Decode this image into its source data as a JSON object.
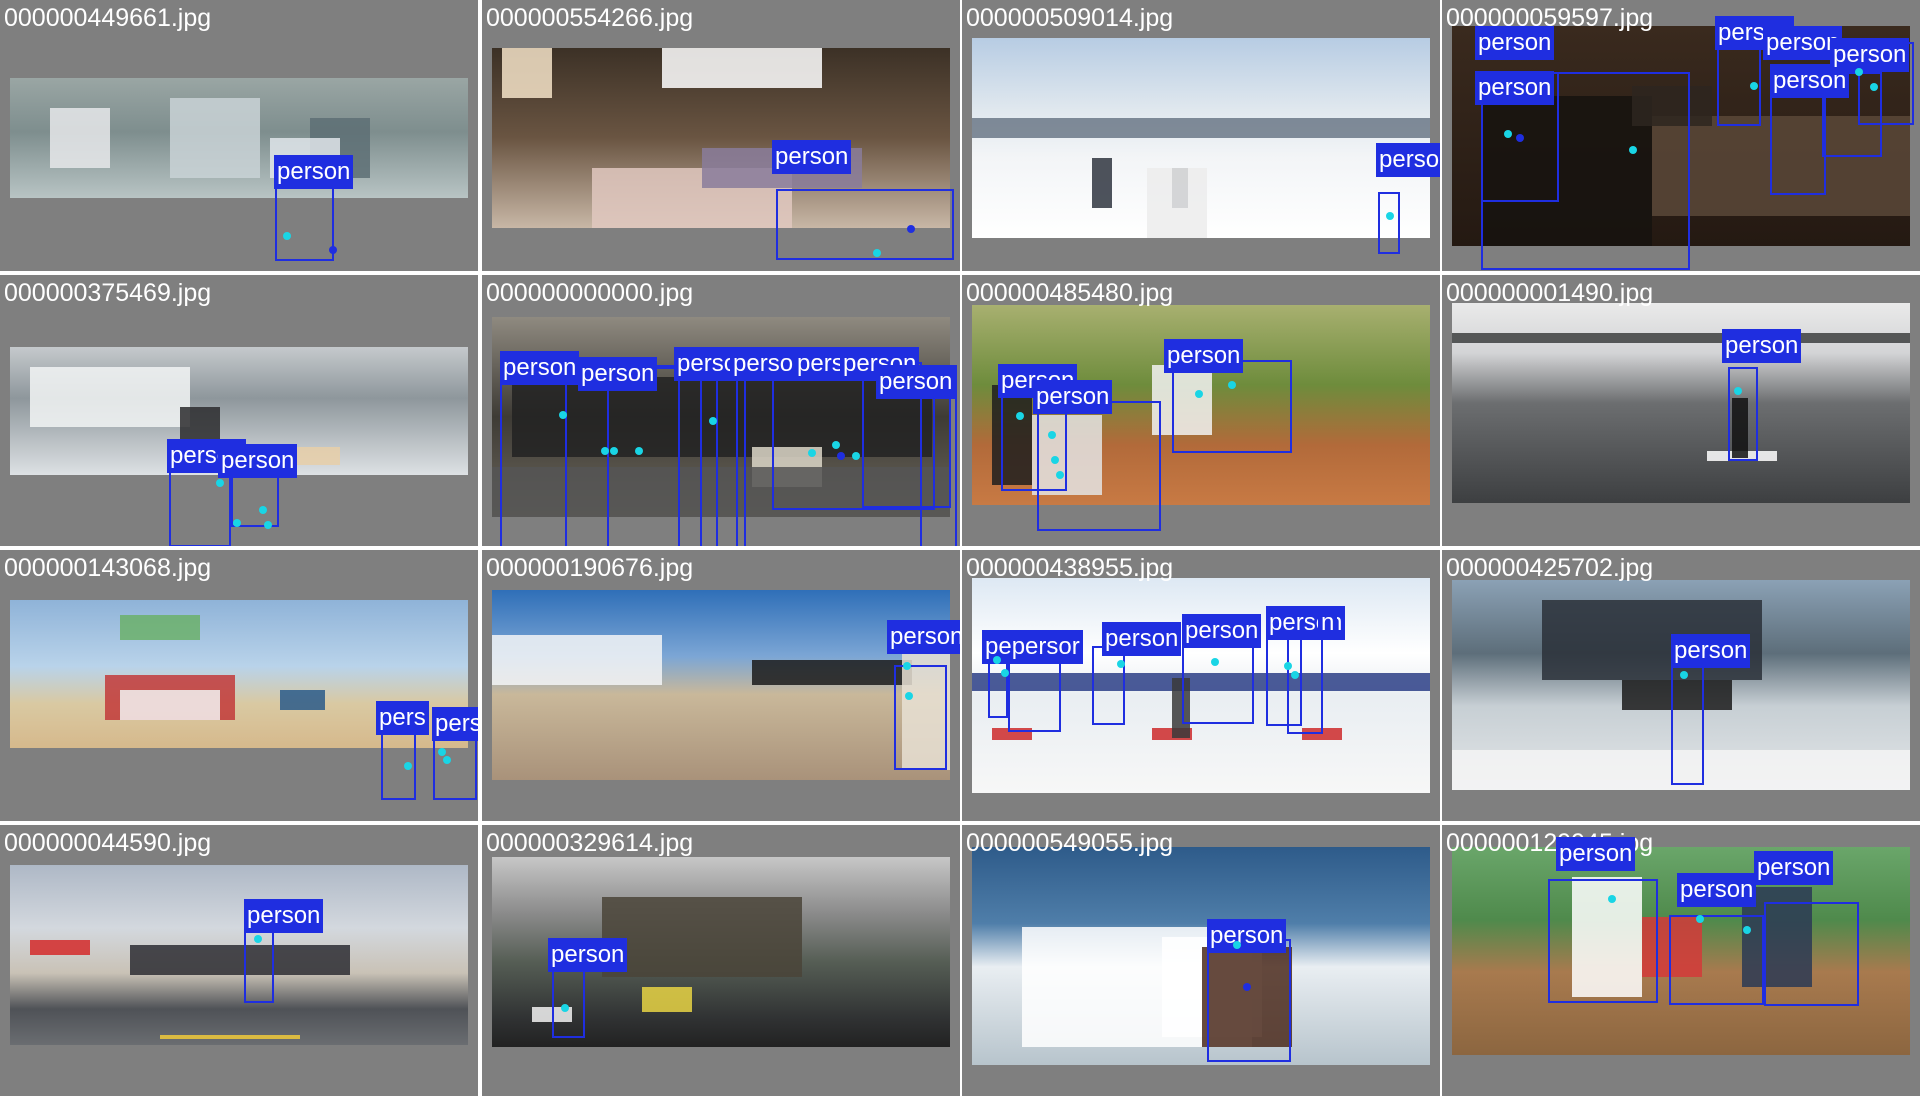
{
  "colors": {
    "tile_bg": "#7f7f7f",
    "box": "#1f2ee0",
    "label_text": "#ffffff",
    "keypoint": "#19d5e5"
  },
  "tiles": [
    {
      "filename": "000000449661.jpg",
      "scene": "hospital room with patient in bed",
      "labels": [
        "person"
      ]
    },
    {
      "filename": "000000554266.jpg",
      "scene": "bedroom panorama with person lying on bed",
      "labels": [
        "person"
      ]
    },
    {
      "filename": "000000509014.jpg",
      "scene": "snowy ski slope with skiers",
      "labels": [
        "person"
      ]
    },
    {
      "filename": "000000059597.jpg",
      "scene": "crowded dim room, boy taking photo with phone",
      "labels": [
        "person",
        "person",
        "person",
        "person",
        "person",
        "person"
      ]
    },
    {
      "filename": "000000375469.jpg",
      "scene": "surfers riding ocean wave",
      "labels": [
        "person",
        "person"
      ]
    },
    {
      "filename": "000000000000.jpg",
      "scene": "vintage photo of seated schoolboys",
      "labels": [
        "person",
        "person",
        "person",
        "person",
        "person",
        "person",
        "person"
      ]
    },
    {
      "filename": "000000485480.jpg",
      "scene": "baseball batter, catcher and umpire at home plate",
      "labels": [
        "person",
        "person",
        "person"
      ]
    },
    {
      "filename": "000000001490.jpg",
      "scene": "paddle boarder on grey water",
      "labels": [
        "person"
      ]
    },
    {
      "filename": "000000143068.jpg",
      "scene": "beach with kites, flags and pier",
      "labels": [
        "pers",
        "person"
      ]
    },
    {
      "filename": "000000190676.jpg",
      "scene": "airport apron with airplane and queue of people",
      "labels": [
        "person"
      ]
    },
    {
      "filename": "000000438955.jpg",
      "scene": "cross-country ski race in snow",
      "labels": [
        "pepersor",
        "person",
        "person",
        "person",
        "n"
      ]
    },
    {
      "filename": "000000425702.jpg",
      "scene": "surfer carrying board on beach under mountain",
      "labels": [
        "person"
      ]
    },
    {
      "filename": "000000044590.jpg",
      "scene": "motorcycles parked along a road",
      "labels": [
        "person"
      ]
    },
    {
      "filename": "000000329614.jpg",
      "scene": "cathedral street scene with bus",
      "labels": [
        "person"
      ]
    },
    {
      "filename": "000000549055.jpg",
      "scene": "surfer wiping out in white water",
      "labels": [
        "person"
      ]
    },
    {
      "filename": "000000129945.jpg",
      "scene": "baseball batter swinging, catcher and umpire",
      "labels": [
        "person",
        "person",
        "person"
      ]
    }
  ]
}
